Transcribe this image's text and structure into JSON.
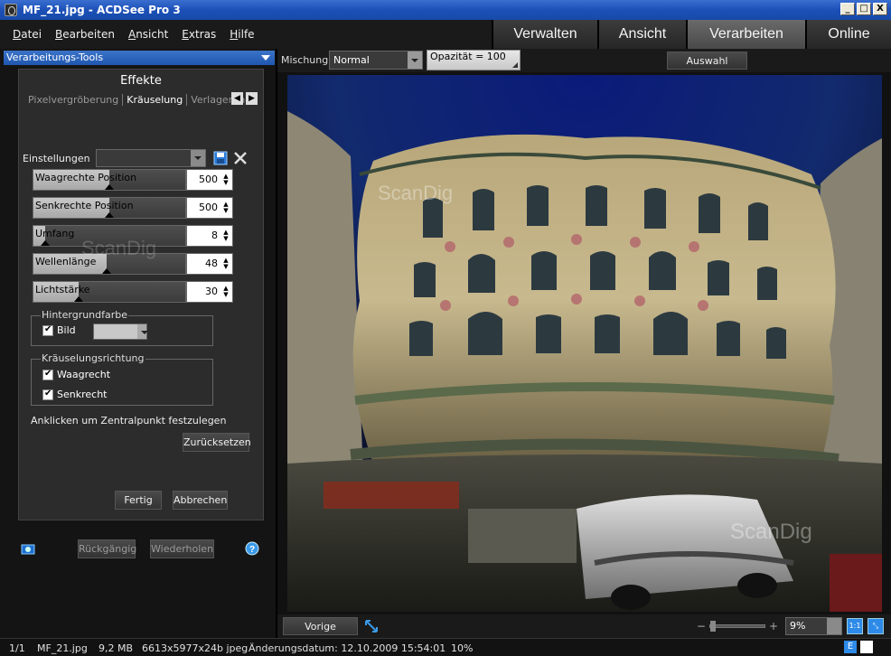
{
  "window": {
    "title": "MF_21.jpg - ACDSee Pro 3",
    "minimize": "_",
    "maximize": "□",
    "close": "X"
  },
  "menu": [
    "Datei",
    "Bearbeiten",
    "Ansicht",
    "Extras",
    "Hilfe"
  ],
  "modes": [
    {
      "label": "Verwalten",
      "active": false
    },
    {
      "label": "Ansicht",
      "active": false
    },
    {
      "label": "Verarbeiten",
      "active": true
    },
    {
      "label": "Online",
      "active": false
    }
  ],
  "panel": {
    "header": "Verarbeitungs-Tools",
    "effect_title": "Effekte",
    "effect_tabs": [
      "Pixelvergröberung",
      "Kräuselung",
      "Verlagerung"
    ],
    "active_tab": "Kräuselung",
    "settings_label": "Einstellungen",
    "settings_value": "",
    "sliders": [
      {
        "label": "Waagrechte Position",
        "value": "500",
        "fraction": 0.5
      },
      {
        "label": "Senkrechte Position",
        "value": "500",
        "fraction": 0.5
      },
      {
        "label": "Umfang",
        "value": "8",
        "fraction": 0.08
      },
      {
        "label": "Wellenlänge",
        "value": "48",
        "fraction": 0.48
      },
      {
        "label": "Lichtstärke",
        "value": "30",
        "fraction": 0.3
      }
    ],
    "background_group": {
      "legend": "Hintergrundfarbe",
      "checkbox_label": "Bild",
      "checked": true
    },
    "direction_group": {
      "legend": "Kräuselungsrichtung",
      "horizontal": "Waagrecht",
      "vertical": "Senkrecht"
    },
    "hint": "Anklicken um Zentralpunkt festzulegen",
    "reset": "Zurücksetzen",
    "done": "Fertig",
    "cancel": "Abbrechen",
    "undo": "Rückgängig",
    "redo": "Wiederholen"
  },
  "toolbar": {
    "blend_label": "Mischung",
    "blend_value": "Normal",
    "opacity": "Opazität = 100",
    "selection_button": "Auswahl erstellen"
  },
  "canvas": {
    "watermark": "ScanDig"
  },
  "bottom": {
    "prev_button": "Vorige anzeigen",
    "zoom_value": "9%",
    "fit_label": "1:1"
  },
  "status": {
    "index": "1/1",
    "filename": "MF_21.jpg",
    "size": "9,2 MB",
    "dimensions": "6613x5977x24b jpeg",
    "modified": "Änderungsdatum: 12.10.2009 15:54:01",
    "zoom": "10%",
    "e_icon": "E"
  }
}
